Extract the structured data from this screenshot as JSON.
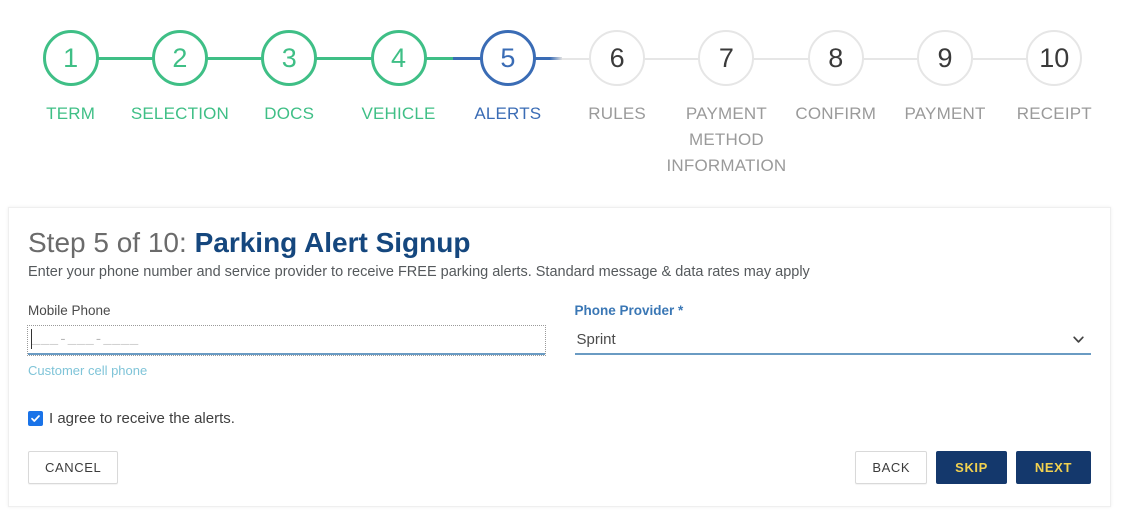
{
  "stepper": {
    "steps": [
      {
        "number": "1",
        "label": "TERM",
        "state": "done"
      },
      {
        "number": "2",
        "label": "SELECTION",
        "state": "done"
      },
      {
        "number": "3",
        "label": "DOCS",
        "state": "done"
      },
      {
        "number": "4",
        "label": "VEHICLE",
        "state": "done"
      },
      {
        "number": "5",
        "label": "ALERTS",
        "state": "active"
      },
      {
        "number": "6",
        "label": "RULES",
        "state": "todo"
      },
      {
        "number": "7",
        "label": "PAYMENT METHOD INFORMATION",
        "state": "todo"
      },
      {
        "number": "8",
        "label": "CONFIRM",
        "state": "todo"
      },
      {
        "number": "9",
        "label": "PAYMENT",
        "state": "todo"
      },
      {
        "number": "10",
        "label": "RECEIPT",
        "state": "todo"
      }
    ],
    "colors": {
      "done": "#3fbf86",
      "active": "#3a6cb5",
      "todo": "#9a9a9a",
      "connector_inactive": "#e6e6e6"
    }
  },
  "card": {
    "title_prefix": "Step 5 of 10: ",
    "title_accent": "Parking Alert Signup",
    "description": "Enter your phone number and service provider to receive FREE parking alerts. Standard message & data rates may apply",
    "mobile_phone": {
      "label": "Mobile Phone",
      "value": "",
      "placeholder": "___-___-____",
      "helper": "Customer cell phone"
    },
    "phone_provider": {
      "label": "Phone Provider *",
      "value": "Sprint"
    },
    "agree": {
      "label": "I agree to receive the alerts.",
      "checked": true
    },
    "buttons": {
      "cancel": "CANCEL",
      "back": "BACK",
      "skip": "SKIP",
      "next": "NEXT"
    },
    "colors": {
      "title_accent": "#15477e",
      "primary_button_bg": "#14386c",
      "primary_button_text": "#f2d14f",
      "required_label": "#3a77b5",
      "helper_text": "#7fc4d8",
      "input_underline": "#6a9bc3",
      "checkbox": "#1a73e8"
    }
  }
}
